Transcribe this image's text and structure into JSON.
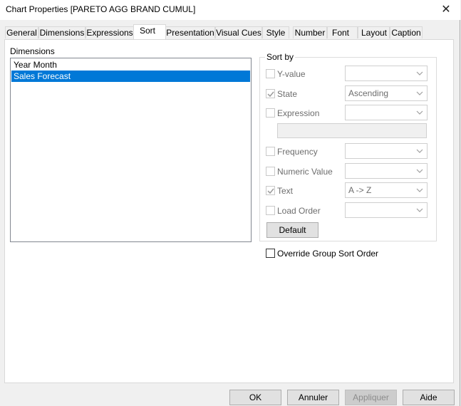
{
  "window": {
    "title": "Chart Properties [PARETO AGG BRAND CUMUL]"
  },
  "tabs": [
    "General",
    "Dimensions",
    "Expressions",
    "Sort",
    "Presentation",
    "Visual Cues",
    "Style",
    "Number",
    "Font",
    "Layout",
    "Caption"
  ],
  "active_tab": "Sort",
  "dimensions": {
    "label": "Dimensions",
    "items": [
      "Year Month",
      "Sales Forecast"
    ],
    "selected": "Sales Forecast"
  },
  "sort_by": {
    "title": "Sort by",
    "y_value": {
      "label": "Y-value",
      "checked": false,
      "value": ""
    },
    "state": {
      "label": "State",
      "checked": true,
      "value": "Ascending"
    },
    "expression": {
      "label": "Expression",
      "checked": false,
      "value": "",
      "edit": ""
    },
    "frequency": {
      "label": "Frequency",
      "checked": false,
      "value": ""
    },
    "numeric_value": {
      "label": "Numeric Value",
      "checked": false,
      "value": ""
    },
    "text": {
      "label": "Text",
      "checked": true,
      "value": "A -> Z"
    },
    "load_order": {
      "label": "Load Order",
      "checked": false,
      "value": ""
    },
    "default_button": "Default"
  },
  "override": {
    "label": "Override Group Sort Order",
    "checked": false
  },
  "footer": {
    "ok": "OK",
    "cancel": "Annuler",
    "apply": "Appliquer",
    "help": "Aide"
  }
}
